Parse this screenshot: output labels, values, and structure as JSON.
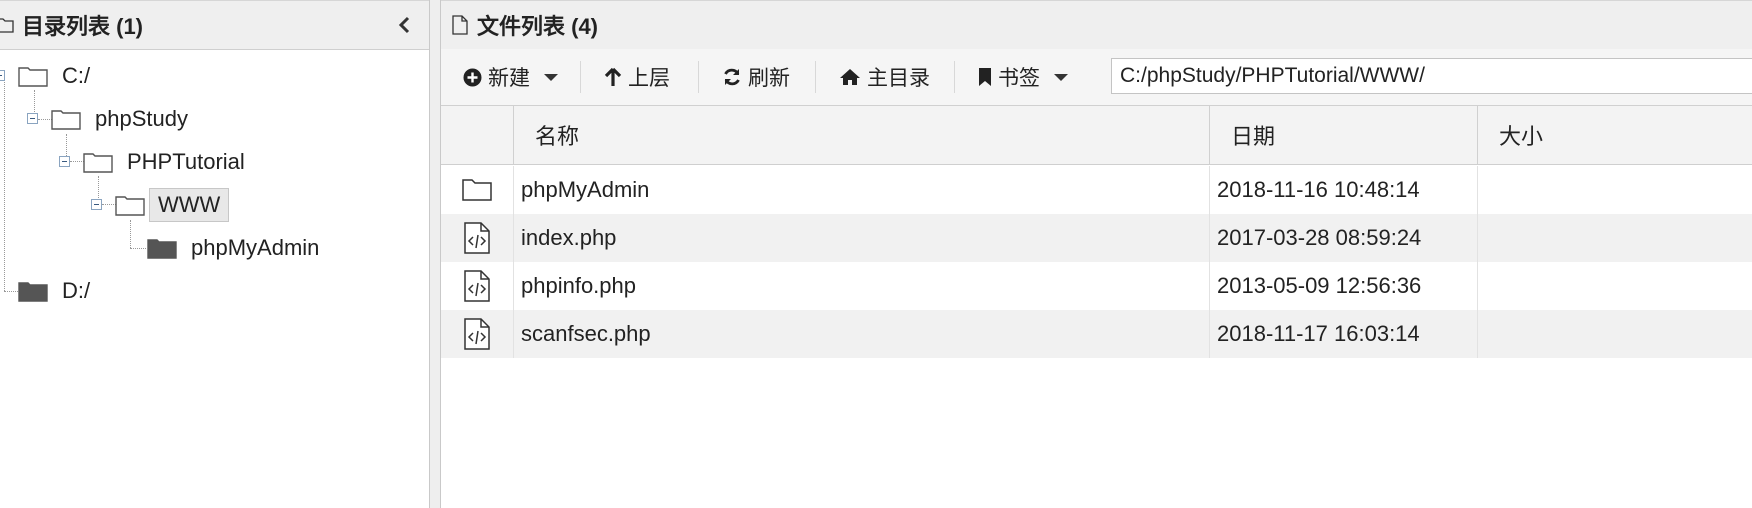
{
  "left_panel": {
    "title": "目录列表 (1)",
    "tree": [
      {
        "label": "C:/"
      },
      {
        "label": "phpStudy"
      },
      {
        "label": "PHPTutorial"
      },
      {
        "label": "WWW"
      },
      {
        "label": "phpMyAdmin"
      },
      {
        "label": "D:/"
      }
    ]
  },
  "right_panel": {
    "title": "文件列表 (4)",
    "toolbar": {
      "new_label": "新建",
      "up_label": "上层",
      "refresh_label": "刷新",
      "home_label": "主目录",
      "bookmark_label": "书签",
      "path_value": "C:/phpStudy/PHPTutorial/WWW/"
    },
    "columns": {
      "name": "名称",
      "date": "日期",
      "size": "大小"
    },
    "files": [
      {
        "name": "phpMyAdmin",
        "date": "2018-11-16 10:48:14",
        "icon": "folder-icon"
      },
      {
        "name": "index.php",
        "date": "2017-03-28 08:59:24",
        "icon": "code-file-icon"
      },
      {
        "name": "phpinfo.php",
        "date": "2013-05-09 12:56:36",
        "icon": "code-file-icon"
      },
      {
        "name": "scanfsec.php",
        "date": "2018-11-17 16:03:14",
        "icon": "code-file-icon"
      }
    ]
  }
}
